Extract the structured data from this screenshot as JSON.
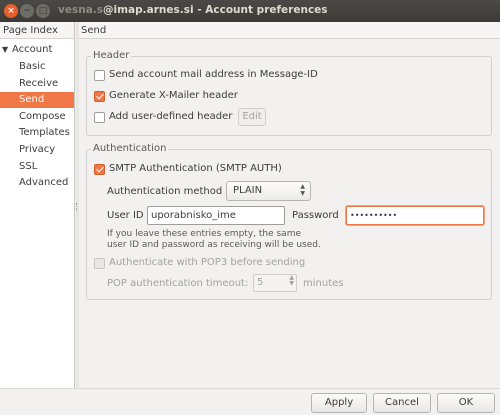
{
  "window": {
    "title_prefix": "vesna.s",
    "title_main": "@imap.arnes.si - Account preferences",
    "buttons": {
      "close": "×",
      "minimize": "−",
      "maximize": "□"
    }
  },
  "sidebar": {
    "header": "Page Index",
    "items": [
      {
        "label": "Account",
        "expanded": true
      },
      {
        "label": "Basic"
      },
      {
        "label": "Receive"
      },
      {
        "label": "Send",
        "selected": true
      },
      {
        "label": "Compose"
      },
      {
        "label": "Templates"
      },
      {
        "label": "Privacy"
      },
      {
        "label": "SSL"
      },
      {
        "label": "Advanced"
      }
    ]
  },
  "page": {
    "title": "Send",
    "header_group": {
      "legend": "Header",
      "send_message_id": {
        "label": "Send account mail address in Message-ID",
        "checked": false
      },
      "x_mailer": {
        "label": "Generate X-Mailer header",
        "checked": true
      },
      "user_defined": {
        "label": "Add user-defined header",
        "checked": false
      },
      "edit_button": "Edit"
    },
    "auth_group": {
      "legend": "Authentication",
      "smtp_auth": {
        "label": "SMTP Authentication (SMTP AUTH)",
        "checked": true
      },
      "method_label": "Authentication method",
      "method_value": "PLAIN",
      "userid_label": "User ID",
      "userid_value": "uporabnisko_ime",
      "password_label": "Password",
      "password_value": "••••••••••",
      "hint_line1": "If you leave these entries empty, the same",
      "hint_line2": "user ID and password as receiving will be used.",
      "pop3_auth": {
        "label": "Authenticate with POP3 before sending",
        "checked": false
      },
      "pop_timeout_label": "POP authentication timeout:",
      "pop_timeout_value": "5",
      "pop_timeout_unit": "minutes"
    }
  },
  "footer": {
    "apply": "Apply",
    "cancel": "Cancel",
    "ok": "OK"
  },
  "colors": {
    "accent": "#f07746",
    "titlebar": "#3c3b37",
    "background": "#f2f1f0"
  }
}
